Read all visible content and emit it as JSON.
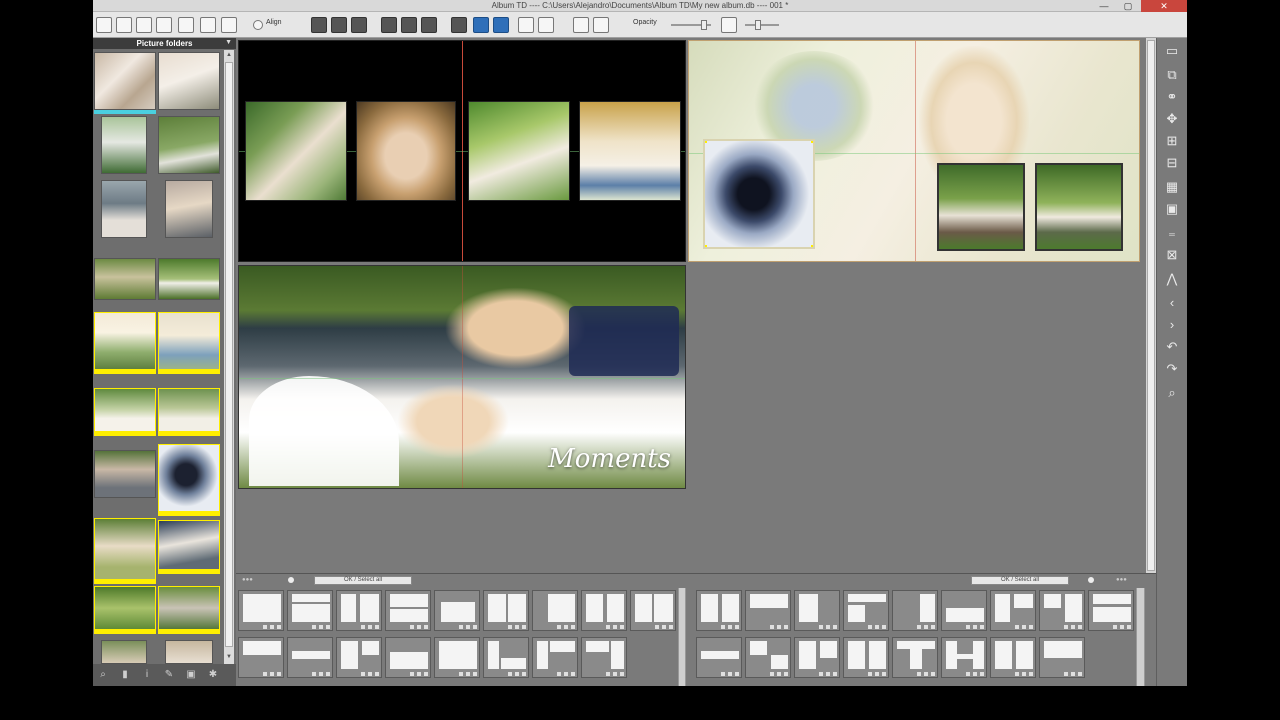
{
  "window": {
    "title": "Album TD ---- C:\\Users\\Alejandro\\Documents\\Album TD\\My new album.db ---- 001 *",
    "min": "—",
    "max": "▢",
    "close": "✕"
  },
  "toolbar": {
    "align_label": "Align",
    "opacity_label": "Opacity"
  },
  "left_panel": {
    "header": "Picture folders",
    "filter_icon": "▼"
  },
  "canvas": {
    "moments_text": "Moments"
  },
  "templates": {
    "left_tab": "OK / Select all",
    "right_tab": "OK / Select all"
  },
  "colors": {
    "selection": "#ffef00",
    "current": "#4ad0e0",
    "guide": "#c84a3a",
    "workspace": "#7a7a7a"
  }
}
